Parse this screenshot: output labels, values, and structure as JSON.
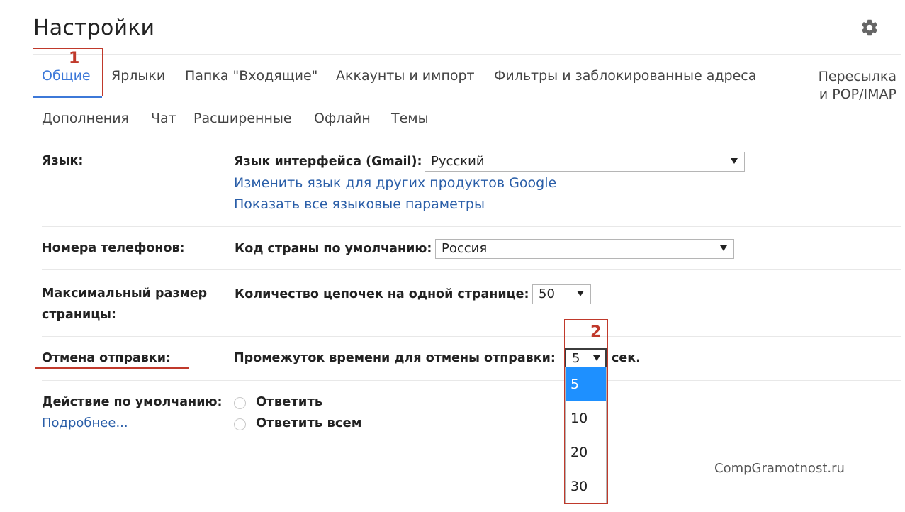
{
  "page": {
    "title": "Настройки"
  },
  "tabs_row1": [
    {
      "label": "Общие",
      "active": true
    },
    {
      "label": "Ярлыки"
    },
    {
      "label": "Папка \"Входящие\""
    },
    {
      "label": "Аккаунты и импорт"
    },
    {
      "label": "Фильтры и заблокированные адреса"
    },
    {
      "label_line1": "Пересылка",
      "label_line2": "и POP/IMAP"
    }
  ],
  "tabs_row2": [
    {
      "label": "Дополнения"
    },
    {
      "label": "Чат"
    },
    {
      "label": "Расширенные"
    },
    {
      "label": "Офлайн"
    },
    {
      "label": "Темы"
    }
  ],
  "annotations": {
    "first": "1",
    "second": "2"
  },
  "language": {
    "label": "Язык:",
    "field_label": "Язык интерфейса (Gmail):",
    "value": "Русский",
    "link_other_products": "Изменить язык для других продуктов Google",
    "link_all_settings": "Показать все языковые параметры"
  },
  "phones": {
    "label": "Номера телефонов:",
    "field_label": "Код страны по умолчанию:",
    "value": "Россия"
  },
  "page_size": {
    "label_line1": "Максимальный размер",
    "label_line2": "страницы:",
    "field_label": "Количество цепочек на одной странице:",
    "value": "50"
  },
  "undo_send": {
    "label": "Отмена отправки:",
    "field_label": "Промежуток времени для отмены отправки:",
    "value": "5",
    "suffix": "сек.",
    "options": [
      "5",
      "10",
      "20",
      "30"
    ],
    "selected_option": "5"
  },
  "default_action": {
    "label": "Действие по умолчанию:",
    "link": "Подробнее...",
    "options": [
      "Ответить",
      "Ответить всем"
    ]
  },
  "watermark": "CompGramotnost.ru",
  "colors": {
    "accent": "#3c78d8",
    "link": "#2a5ea8",
    "annotation": "#c0392b",
    "selection": "#1e90ff"
  },
  "icons": {
    "settings": "gear-icon"
  }
}
